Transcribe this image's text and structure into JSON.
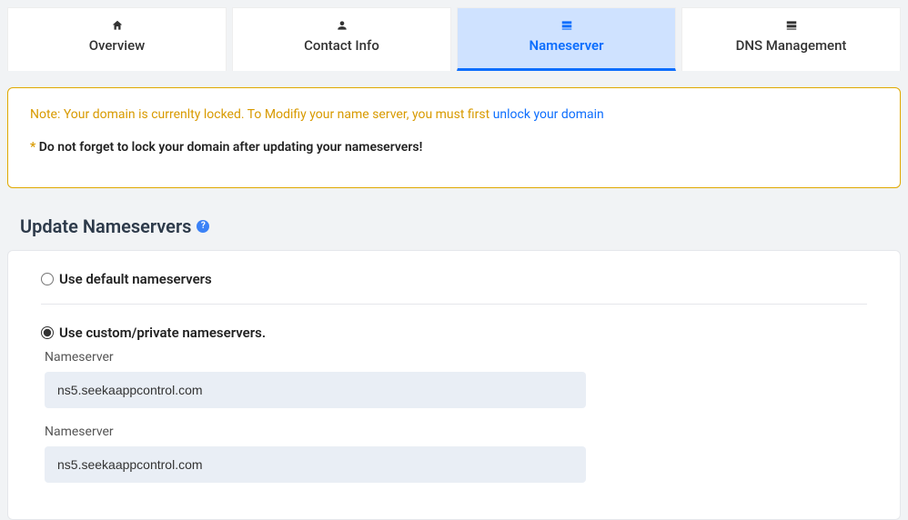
{
  "tabs": [
    {
      "label": "Overview",
      "icon": "home",
      "active": false
    },
    {
      "label": "Contact Info",
      "icon": "user",
      "active": false
    },
    {
      "label": "Nameserver",
      "icon": "server",
      "active": true
    },
    {
      "label": "DNS Management",
      "icon": "server",
      "active": false
    }
  ],
  "alert": {
    "note_prefix": "Note: Your domain is currenlty locked. To Modifiy your name server, you must first ",
    "unlock_link": "unlock your domain",
    "asterisk": "*",
    "reminder": "Do not forget to lock your domain after updating your nameservers!"
  },
  "section_title": "Update Nameservers",
  "options": {
    "default_label": "Use default nameservers",
    "custom_label": "Use custom/private nameservers.",
    "selected": "custom"
  },
  "ns_fields": [
    {
      "label": "Nameserver",
      "value": "ns5.seekaappcontrol.com"
    },
    {
      "label": "Nameserver",
      "value": "ns5.seekaappcontrol.com"
    }
  ]
}
